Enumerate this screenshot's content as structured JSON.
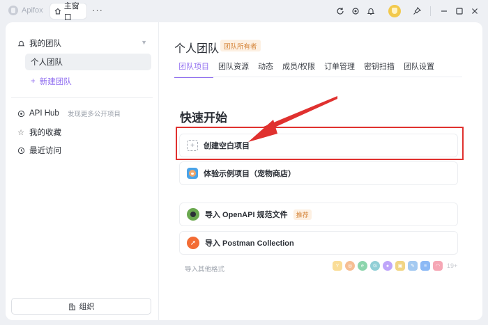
{
  "titlebar": {
    "app_name": "Apifox",
    "home_tab": "主窗口",
    "more": "···",
    "icons": [
      "refresh-icon",
      "settings-icon",
      "bell-icon",
      "avatar",
      "pin-icon",
      "minimize-icon",
      "maximize-icon",
      "close-icon"
    ]
  },
  "sidebar": {
    "my_team": "我的团队",
    "team_item": "个人团队",
    "new_team": "新建团队",
    "api_hub": "API Hub",
    "api_hub_sub": "发现更多公开项目",
    "favorites": "我的收藏",
    "recent": "最近访问",
    "org_button": "组织"
  },
  "main": {
    "team_title": "个人团队",
    "owner_badge": "团队所有者",
    "tabs": [
      "团队项目",
      "团队资源",
      "动态",
      "成员/权限",
      "订单管理",
      "密钥扫描",
      "团队设置"
    ],
    "active_tab": 0,
    "quick_start": "快速开始",
    "cards": {
      "create_blank": "创建空白项目",
      "sample_project": "体验示例项目（宠物商店）",
      "import_openapi": "导入 OpenAPI 规范文件",
      "recommended": "推荐",
      "import_postman": "导入 Postman Collection"
    },
    "other_formats": "导入其他格式",
    "format_count": "19+"
  },
  "colors": {
    "accent": "#8f6cf0",
    "highlight": "#e0312f",
    "badge_bg": "#fdf0e2",
    "badge_text": "#d5863c"
  }
}
